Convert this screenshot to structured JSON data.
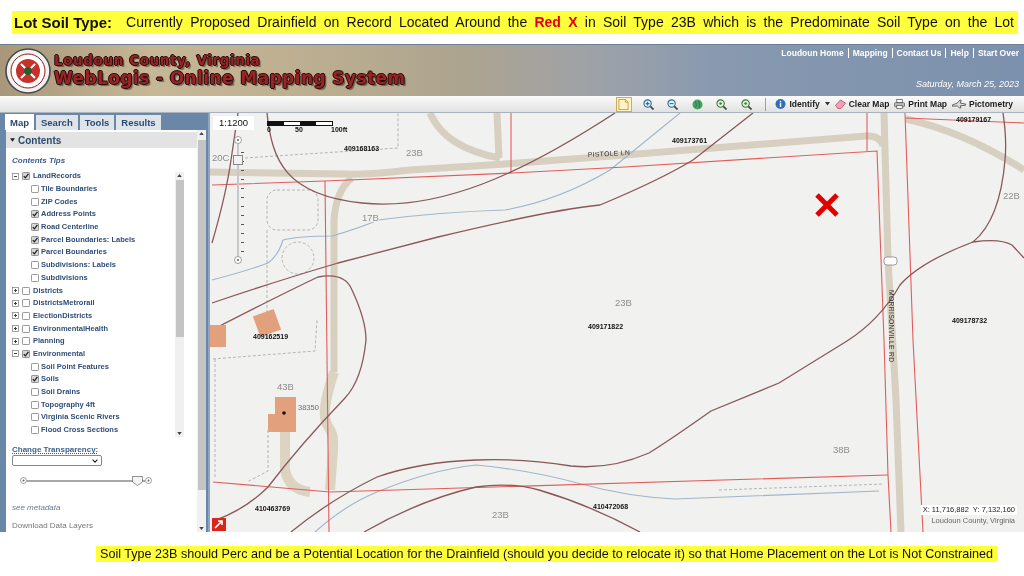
{
  "banner": {
    "label": "Lot Soil Type:",
    "text": "Currently Proposed Drainfield on Record Located Around the **Red X** in Soil Type 23B which is the Predominate Soil Type on the Lot"
  },
  "header": {
    "county": "Loudoun County, Virginia",
    "title": "WebLogis - Online Mapping System",
    "links": [
      "Loudoun Home",
      "Mapping",
      "Contact Us",
      "Help",
      "Start Over"
    ],
    "date": "Saturday, March 25, 2023"
  },
  "toolbar": {
    "tools": [
      {
        "kind": "page",
        "selected": true
      },
      {
        "kind": "zoom-in",
        "selected": false
      },
      {
        "kind": "zoom-out",
        "selected": false
      },
      {
        "kind": "globe",
        "selected": false
      },
      {
        "kind": "zoom-back",
        "selected": false
      },
      {
        "kind": "zoom-forward",
        "selected": false
      }
    ],
    "actions": [
      {
        "kind": "identify",
        "label": "Identify"
      },
      {
        "kind": "clear",
        "label": "Clear Map"
      },
      {
        "kind": "print",
        "label": "Print Map"
      },
      {
        "kind": "pictometry",
        "label": "Pictometry"
      }
    ]
  },
  "sidebar": {
    "tabs": [
      {
        "label": "Map",
        "selected": true
      },
      {
        "label": "Search",
        "selected": false
      },
      {
        "label": "Tools",
        "selected": false
      },
      {
        "label": "Results",
        "selected": false
      }
    ],
    "panel_title": "Contents",
    "tips": "Contents Tips",
    "layers": [
      {
        "label": "LandRecords",
        "checked": true,
        "expanded": true,
        "children": [
          {
            "label": "Tile Boundaries",
            "checked": false
          },
          {
            "label": "ZIP Codes",
            "checked": false
          },
          {
            "label": "Address Points",
            "checked": true
          },
          {
            "label": "Road Centerline",
            "checked": true
          },
          {
            "label": "Parcel Boundaries: Labels",
            "checked": true
          },
          {
            "label": "Parcel Boundaries",
            "checked": true
          },
          {
            "label": "Subdivisions: Labels",
            "checked": false
          },
          {
            "label": "Subdivisions",
            "checked": false
          }
        ]
      },
      {
        "label": "Districts",
        "checked": false,
        "expanded": false
      },
      {
        "label": "DistrictsMetrorail",
        "checked": false,
        "expanded": false
      },
      {
        "label": "ElectionDistricts",
        "checked": false,
        "expanded": false
      },
      {
        "label": "EnvironmentalHealth",
        "checked": false,
        "expanded": false
      },
      {
        "label": "Planning",
        "checked": false,
        "expanded": false
      },
      {
        "label": "Environmental",
        "checked": true,
        "expanded": true,
        "children": [
          {
            "label": "Soil Point Features",
            "checked": false
          },
          {
            "label": "Soils",
            "checked": true
          },
          {
            "label": "Soil Drains",
            "checked": false
          },
          {
            "label": "Topography 4ft",
            "checked": false
          },
          {
            "label": "Virginia Scenic Rivers",
            "checked": false
          },
          {
            "label": "Flood Cross Sections",
            "checked": false
          }
        ]
      }
    ],
    "transparency": {
      "label": "Change Transparency:",
      "level": 0.94
    },
    "links": [
      "see metadata",
      "Download Data Layers"
    ]
  },
  "map": {
    "scale": "1:1200",
    "scalebar": [
      "0",
      "50",
      "100ft"
    ],
    "zoom_slider": {
      "level": 0.89
    },
    "labels": [
      {
        "text": "409179167",
        "kind": "parcel"
      },
      {
        "text": "409173761",
        "kind": "parcel"
      },
      {
        "text": "409168163",
        "kind": "parcel"
      },
      {
        "text": "23B",
        "kind": "soil"
      },
      {
        "text": "PISTOLE LN",
        "kind": "road"
      },
      {
        "text": "20C",
        "kind": "soil"
      },
      {
        "text": "22B",
        "kind": "soil"
      },
      {
        "text": "17B",
        "kind": "soil"
      },
      {
        "text": "MORRISONVILLE RD",
        "kind": "road"
      },
      {
        "text": "23B",
        "kind": "soil"
      },
      {
        "text": "409178732",
        "kind": "parcel"
      },
      {
        "text": "409171822",
        "kind": "parcel"
      },
      {
        "text": "409162519",
        "kind": "parcel"
      },
      {
        "text": "43B",
        "kind": "soil"
      },
      {
        "text": "38350",
        "kind": "address"
      },
      {
        "text": "38B",
        "kind": "soil"
      },
      {
        "text": "410472068",
        "kind": "parcel"
      },
      {
        "text": "410463769",
        "kind": "parcel"
      },
      {
        "text": "23B",
        "kind": "soil"
      }
    ],
    "coordinates": "X: 11,716,882  Y: 7,132,160",
    "region": "Loudoun County, Virginia"
  },
  "caption": "Soil Type 23B should Perc and be a Potential Location for the Drainfield (should you decide to relocate it) so that Home Placement on the Lot is Not Constrained"
}
